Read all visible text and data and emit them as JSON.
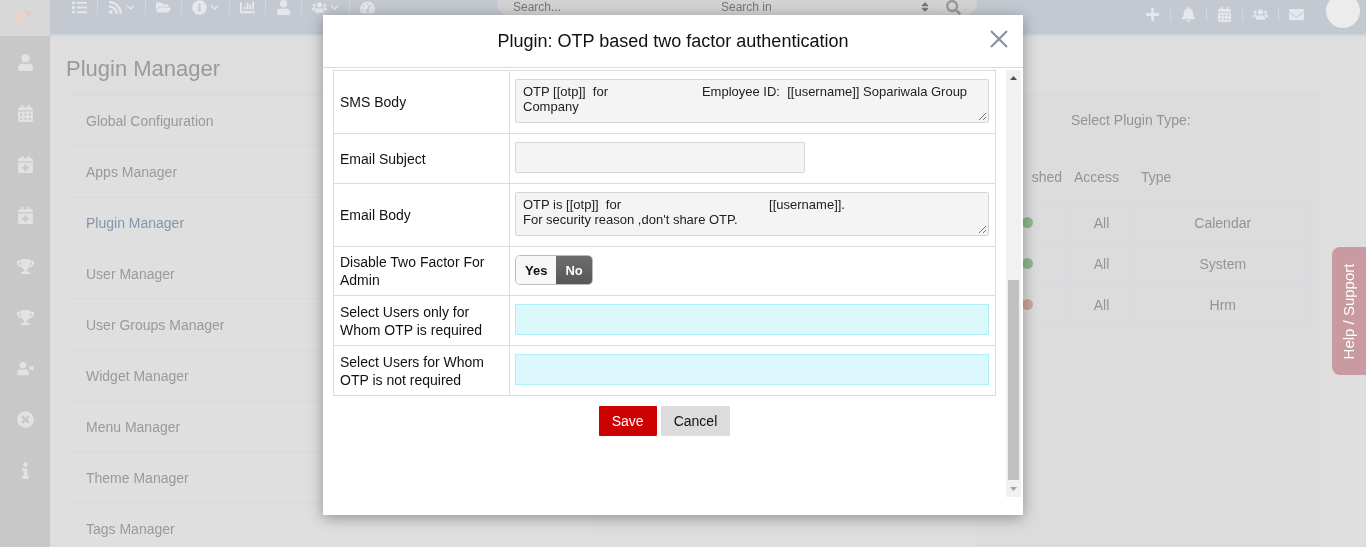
{
  "top_bar": {
    "search": {
      "placeholder": "Search..."
    },
    "search_scope": {
      "placeholder": "Search in"
    }
  },
  "page": {
    "title": "Plugin Manager"
  },
  "manager_menu": [
    {
      "label": "Global Configuration",
      "selected": false
    },
    {
      "label": "Apps Manager",
      "selected": false
    },
    {
      "label": "Plugin Manager",
      "selected": true
    },
    {
      "label": "User Manager",
      "selected": false
    },
    {
      "label": "User Groups Manager",
      "selected": false
    },
    {
      "label": "Widget Manager",
      "selected": false
    },
    {
      "label": "Menu Manager",
      "selected": false
    },
    {
      "label": "Theme Manager",
      "selected": false
    },
    {
      "label": "Tags Manager",
      "selected": false
    }
  ],
  "plugin_panel": {
    "type_label": "Select Plugin Type:",
    "columns": [
      "shed",
      "Access",
      "Type"
    ],
    "rows": [
      {
        "color": "#8fba8f",
        "access": "All",
        "type": "Calendar"
      },
      {
        "color": "#8fba8f",
        "access": "All",
        "type": "System"
      },
      {
        "color": "#cfa59c",
        "access": "All",
        "type": "Hrm"
      }
    ]
  },
  "help_tab": "Help / Support",
  "dialog": {
    "title": "Plugin: OTP based two factor authentication",
    "fields": [
      {
        "kind": "textarea",
        "label": "SMS Body",
        "value": "OTP [[otp]]  for                          Employee ID:  [[username]] Sopariwala Group Company"
      },
      {
        "kind": "text",
        "label": "Email Subject"
      },
      {
        "kind": "textarea",
        "label": "Email Body",
        "value": "OTP is [[otp]]  for                                         [[username]].\nFor security reason ,don't share OTP."
      },
      {
        "kind": "toggle",
        "label": "Disable Two Factor For Admin",
        "options": [
          {
            "label": "Yes",
            "selected": false
          },
          {
            "label": "No",
            "selected": true
          }
        ]
      },
      {
        "kind": "select",
        "label": "Select Users only for Whom OTP is required"
      },
      {
        "kind": "select",
        "label": "Select Users for Whom OTP is not required"
      }
    ],
    "buttons": [
      {
        "kind": "primary",
        "label": "Save"
      },
      {
        "kind": "secondary",
        "label": "Cancel"
      }
    ]
  }
}
